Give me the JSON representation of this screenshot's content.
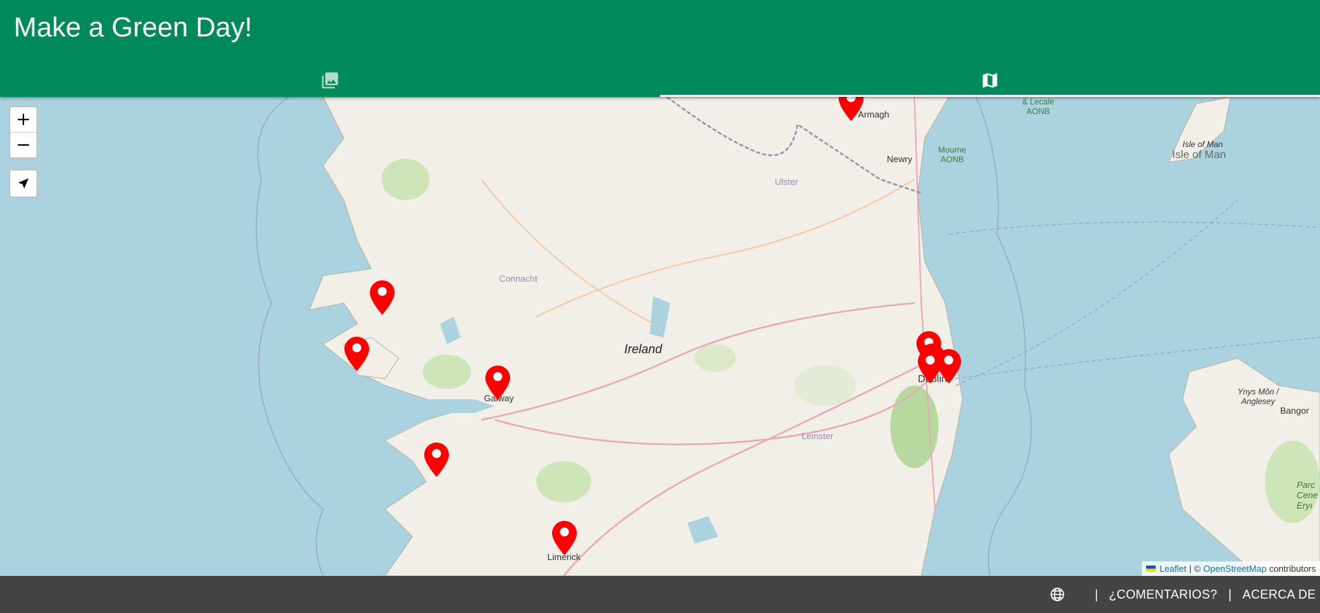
{
  "app": {
    "title": "Make a Green Day!"
  },
  "tabs": [
    {
      "icon": "photo-library-icon",
      "active": false
    },
    {
      "icon": "map-icon",
      "active": true
    }
  ],
  "map": {
    "zoom_in_label": "+",
    "zoom_out_label": "−",
    "labels": {
      "armagh": "Armagh",
      "newry": "Newry",
      "ulster": "Ulster",
      "isle_of_man": "Isle of Man",
      "isle_of_man_small": "Isle of Man",
      "connacht": "Connacht",
      "ireland": "Ireland",
      "galway": "Galway",
      "dublin": "Dublin",
      "leinster": "Leinster",
      "limerick": "Limerick",
      "bangor": "Bangor",
      "ynys_mon": "Ynys Môn / Anglesey",
      "mourne": "Mourne AONB",
      "lecale": "& Lecale AONB",
      "parc": "Parc Cene Eryı"
    },
    "marker_count": 10
  },
  "attribution": {
    "leaflet": "Leaflet",
    "separator": "| ©",
    "osm": "OpenStreetMap",
    "suffix": "contributors"
  },
  "footer": {
    "feedback": "¿COMENTARIOS?",
    "about": "ACERCA DE",
    "separator": "|"
  }
}
